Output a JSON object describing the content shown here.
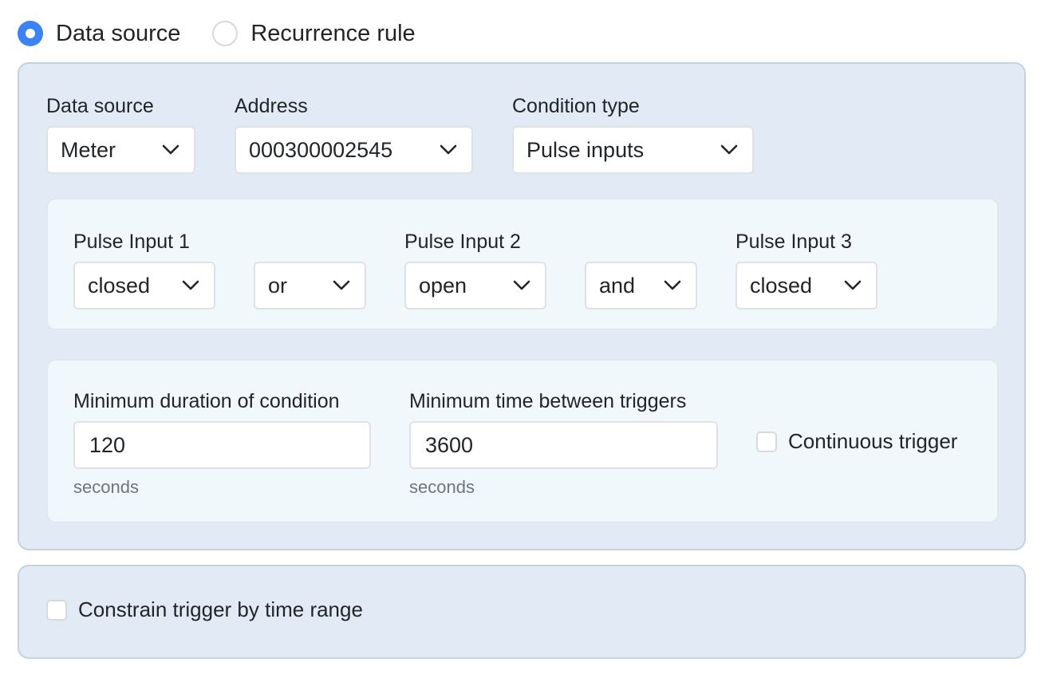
{
  "mode": {
    "options": [
      {
        "label": "Data source",
        "checked": true
      },
      {
        "label": "Recurrence rule",
        "checked": false
      }
    ]
  },
  "source": {
    "data_source": {
      "label": "Data source",
      "value": "Meter"
    },
    "address": {
      "label": "Address",
      "value": "000300002545"
    },
    "condition_type": {
      "label": "Condition type",
      "value": "Pulse inputs"
    }
  },
  "pulse": {
    "input1": {
      "label": "Pulse Input 1",
      "value": "closed"
    },
    "op1": {
      "value": "or"
    },
    "input2": {
      "label": "Pulse Input 2",
      "value": "open"
    },
    "op2": {
      "value": "and"
    },
    "input3": {
      "label": "Pulse Input 3",
      "value": "closed"
    }
  },
  "timing": {
    "min_duration": {
      "label": "Minimum duration of condition",
      "value": "120",
      "unit": "seconds"
    },
    "min_between": {
      "label": "Minimum time between triggers",
      "value": "3600",
      "unit": "seconds"
    },
    "continuous": {
      "label": "Continuous trigger",
      "checked": false
    }
  },
  "constraint": {
    "label": "Constrain trigger by time range",
    "checked": false
  },
  "icons": {
    "select_chevron": "chevron-down-icon"
  },
  "colors": {
    "accent": "#3b82f6",
    "panel_bg": "#e2ebf5",
    "inner_bg": "#f1f8fb"
  }
}
